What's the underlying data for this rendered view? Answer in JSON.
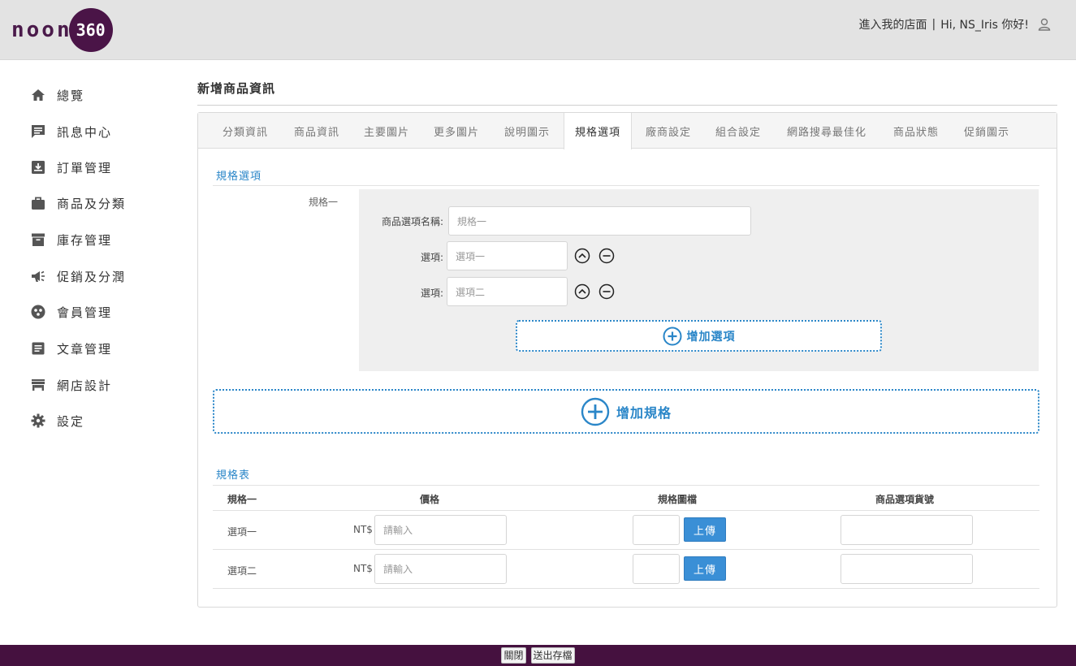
{
  "header": {
    "logo_text": "noon",
    "logo_badge": "360",
    "store_link": "進入我的店面",
    "separator": "|",
    "greeting": "Hi, NS_Iris 你好!"
  },
  "sidebar": {
    "items": [
      {
        "label": "總覽",
        "icon": "home-icon"
      },
      {
        "label": "訊息中心",
        "icon": "message-icon"
      },
      {
        "label": "訂單管理",
        "icon": "order-icon"
      },
      {
        "label": "商品及分類",
        "icon": "briefcase-icon"
      },
      {
        "label": "庫存管理",
        "icon": "archive-icon"
      },
      {
        "label": "促銷及分潤",
        "icon": "megaphone-icon"
      },
      {
        "label": "會員管理",
        "icon": "members-icon"
      },
      {
        "label": "文章管理",
        "icon": "article-icon"
      },
      {
        "label": "網店設計",
        "icon": "store-icon"
      },
      {
        "label": "設定",
        "icon": "gear-icon"
      }
    ]
  },
  "page": {
    "title": "新增商品資訊"
  },
  "tabs": [
    "分類資訊",
    "商品資訊",
    "主要圖片",
    "更多圖片",
    "說明圖示",
    "規格選項",
    "廠商設定",
    "組合設定",
    "網路搜尋最佳化",
    "商品狀態",
    "促銷圖示"
  ],
  "active_tab": "規格選項",
  "spec_section": {
    "title": "規格選項",
    "spec_label": "規格一",
    "name_label": "商品選項名稱:",
    "name_placeholder": "規格一",
    "option_label": "選項:",
    "options": [
      {
        "placeholder": "選項一"
      },
      {
        "placeholder": "選項二"
      }
    ],
    "add_option_label": "增加選項",
    "add_spec_label": "增加規格"
  },
  "spec_table": {
    "title": "規格表",
    "headers": [
      "規格一",
      "價格",
      "規格圖檔",
      "商品選項貨號"
    ],
    "currency": "NT$",
    "price_placeholder": "請輸入",
    "upload_label": "上傳",
    "rows": [
      {
        "option": "選項一"
      },
      {
        "option": "選項二"
      }
    ]
  },
  "footer": {
    "close_label": "關閉",
    "submit_label": "送出存檔"
  },
  "colors": {
    "accent": "#2a86c8",
    "brand": "#45113f",
    "upload": "#3a8fd6"
  }
}
